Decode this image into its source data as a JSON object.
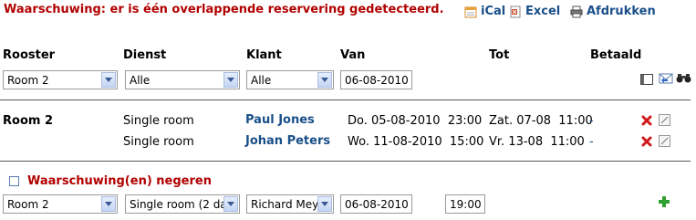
{
  "warning": "Waarschuwing: er is één overlappende reservering gedetecteerd.",
  "toplinks": {
    "ical": "iCal",
    "excel": "Excel",
    "print": "Afdrukken"
  },
  "headers": {
    "rooster": "Rooster",
    "dienst": "Dienst",
    "klant": "Klant",
    "van": "Van",
    "tot": "Tot",
    "betaald": "Betaald"
  },
  "filters": {
    "rooster": "Room 2",
    "dienst": "Alle",
    "klant": "Alle",
    "van": "06-08-2010"
  },
  "reservations": {
    "room": "Room 2",
    "rows": [
      {
        "dienst": "Single room",
        "klant": "Paul Jones",
        "van": "Do. 05-08-2010  23:00",
        "tot": "Zat. 07-08  11:00",
        "betaald": "-"
      },
      {
        "dienst": "Single room",
        "klant": "Johan Peters",
        "van": "Wo. 11-08-2010  15:00",
        "tot": "Vr. 13-08  11:00",
        "betaald": "-"
      }
    ]
  },
  "ignore_label": "Waarschuwing(en) negeren",
  "new_entry": {
    "rooster": "Room 2",
    "dienst": "Single room (2 da",
    "klant": "Richard Mey",
    "van": "06-08-2010",
    "time": "19:00"
  },
  "colors": {
    "warning": "#b10000",
    "link": "#1a4f8a",
    "add": "#2fa02f",
    "delete": "#d21a1a"
  }
}
